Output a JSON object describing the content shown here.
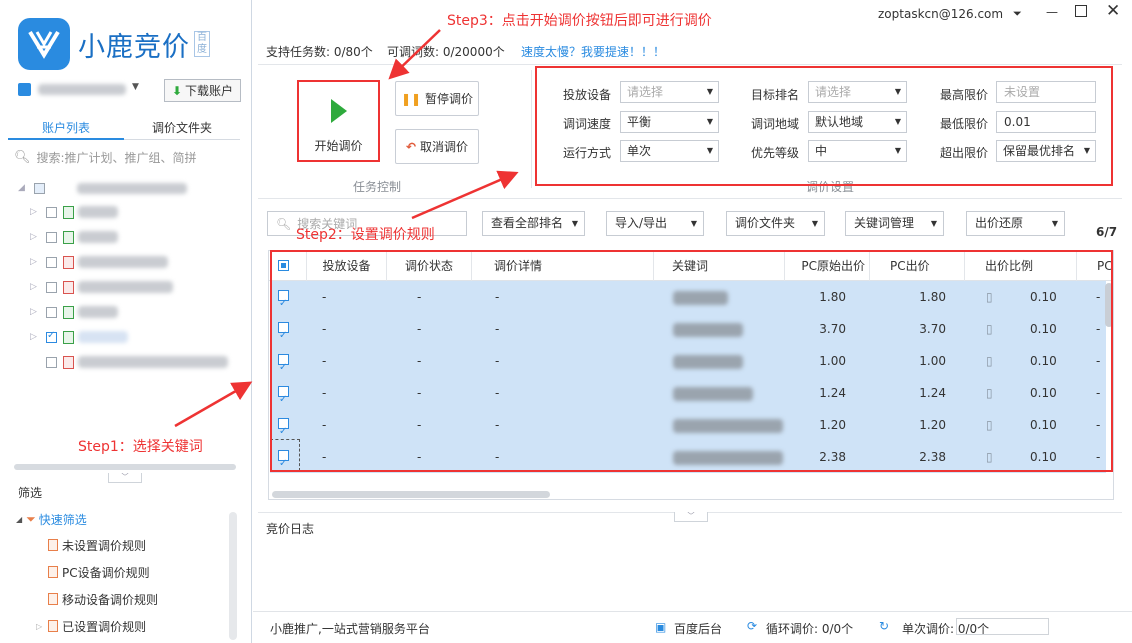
{
  "brand": {
    "name": "小鹿竞价",
    "badge": "百度"
  },
  "account": {
    "download_label": "下载账户"
  },
  "sidebar": {
    "tabs": [
      "账户列表",
      "调价文件夹"
    ],
    "search_placeholder": "搜索:推广计划、推广组、简拼"
  },
  "filter": {
    "title": "筛选",
    "quick": "快速筛选",
    "items": [
      "未设置调价规则",
      "PC设备调价规则",
      "移动设备调价规则",
      "已设置调价规则"
    ]
  },
  "window": {
    "user": "zoptaskcn@126.com"
  },
  "topinfo": {
    "tasks": "支持任务数: 0/80个",
    "words": "可调词数: 0/20000个",
    "speedup": "速度太慢？我要提速！！！"
  },
  "controls": {
    "start": "开始调价",
    "pause": "暂停调价",
    "cancel": "取消调价",
    "section": "任务控制"
  },
  "settings": {
    "section": "调价设置",
    "device_label": "投放设备",
    "device_value": "请选择",
    "speed_label": "调词速度",
    "speed_value": "平衡",
    "mode_label": "运行方式",
    "mode_value": "单次",
    "rank_label": "目标排名",
    "rank_value": "请选择",
    "region_label": "调词地域",
    "region_value": "默认地域",
    "priority_label": "优先等级",
    "priority_value": "中",
    "max_label": "最高限价",
    "max_value": "未设置",
    "min_label": "最低限价",
    "min_value": "0.01",
    "exceed_label": "超出限价",
    "exceed_value": "保留最优排名"
  },
  "toolbar": {
    "search_placeholder": "搜索关键词",
    "view_rank": "查看全部排名",
    "import_export": "导入/导出",
    "folder": "调价文件夹",
    "keyword_mgmt": "关键词管理",
    "restore": "出价还原",
    "page": "6/7"
  },
  "table": {
    "headers": [
      "投放设备",
      "调价状态",
      "调价详情",
      "关键词",
      "PC原始出价",
      "PC出价",
      "出价比例",
      "PC"
    ],
    "rows": [
      {
        "device": "-",
        "status": "-",
        "detail": "-",
        "orig": "1.80",
        "pc": "1.80",
        "ratio": "0.10",
        "last": "-"
      },
      {
        "device": "-",
        "status": "-",
        "detail": "-",
        "orig": "3.70",
        "pc": "3.70",
        "ratio": "0.10",
        "last": "-"
      },
      {
        "device": "-",
        "status": "-",
        "detail": "-",
        "orig": "1.00",
        "pc": "1.00",
        "ratio": "0.10",
        "last": "-"
      },
      {
        "device": "-",
        "status": "-",
        "detail": "-",
        "orig": "1.24",
        "pc": "1.24",
        "ratio": "0.10",
        "last": "-"
      },
      {
        "device": "-",
        "status": "-",
        "detail": "-",
        "orig": "1.20",
        "pc": "1.20",
        "ratio": "0.10",
        "last": "-"
      },
      {
        "device": "-",
        "status": "-",
        "detail": "-",
        "orig": "2.38",
        "pc": "2.38",
        "ratio": "0.10",
        "last": "-"
      }
    ]
  },
  "log": {
    "title": "竞价日志"
  },
  "annotations": {
    "step1": "Step1：选择关键词",
    "step2": "Step2：设置调价规则",
    "step3": "Step3：点击开始调价按钮后即可进行调价"
  },
  "status": {
    "slogan": "小鹿推广,一站式营销服务平台",
    "backend": "百度后台",
    "loop": "循环调价: 0/0个",
    "single": "单次调价: 0/0个"
  },
  "colors": {
    "accent": "#2a8be0",
    "annotation": "#e33333",
    "row_selected": "#cfe3f7",
    "start_green": "#2eaa3c"
  }
}
